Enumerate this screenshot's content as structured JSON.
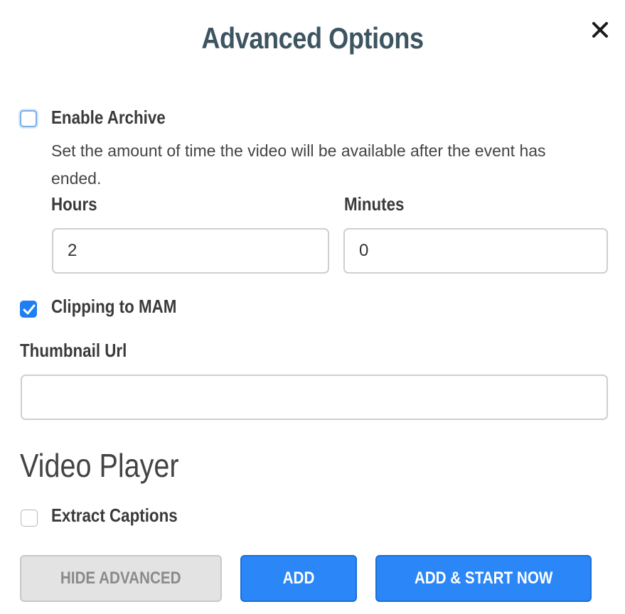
{
  "dialog": {
    "title": "Advanced Options",
    "close_icon": "close-icon"
  },
  "archive": {
    "label": "Enable Archive",
    "checked": false,
    "description": "Set the amount of time the video will be available after the event has ended.",
    "hours_label": "Hours",
    "hours_value": "2",
    "minutes_label": "Minutes",
    "minutes_value": "0"
  },
  "clipping": {
    "label": "Clipping to MAM",
    "checked": true
  },
  "thumbnail": {
    "label": "Thumbnail Url",
    "value": ""
  },
  "video_player": {
    "heading": "Video Player",
    "extract_captions_label": "Extract Captions",
    "extract_captions_checked": false
  },
  "actions": {
    "hide_advanced_label": "HIDE ADVANCED",
    "add_label": "ADD",
    "add_start_label": "ADD & START NOW"
  },
  "colors": {
    "title": "#3d5561",
    "primary_button": "#2b87f7",
    "checkbox_checked": "#1e7ef2",
    "secondary_button": "#e3e3e3"
  }
}
